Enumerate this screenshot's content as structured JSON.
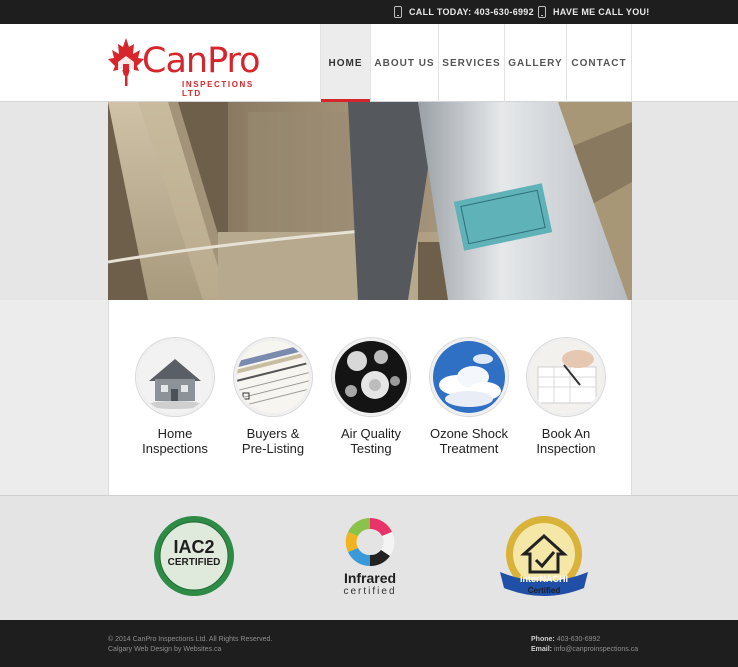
{
  "topbar": {
    "call_today": "CALL TODAY: 403-630-6992",
    "call_me": "HAVE ME CALL YOU!"
  },
  "logo": {
    "name": "CanPro",
    "subtitle": "INSPECTIONS LTD"
  },
  "nav": {
    "items": [
      {
        "label": "HOME",
        "active": true
      },
      {
        "label": "ABOUT US",
        "active": false
      },
      {
        "label": "SERVICES",
        "active": false
      },
      {
        "label": "GALLERY",
        "active": false
      },
      {
        "label": "CONTACT",
        "active": false
      }
    ]
  },
  "services": [
    {
      "line1": "Home",
      "line2": "Inspections",
      "image": "house-model"
    },
    {
      "line1": "Buyers &",
      "line2": "Pre-Listing",
      "image": "home-inspection-checklist"
    },
    {
      "line1": "Air Quality",
      "line2": "Testing",
      "image": "mold-spores"
    },
    {
      "line1": "Ozone Shock",
      "line2": "Treatment",
      "image": "blue-sky-clouds"
    },
    {
      "line1": "Book An",
      "line2": "Inspection",
      "image": "calendar-writing"
    }
  ],
  "badges": {
    "iac2": {
      "main": "IAC2",
      "sub": "CERTIFIED"
    },
    "infrared": {
      "main": "Infrared",
      "sub": "certified"
    },
    "internachi": {
      "main": "InterNACHI",
      "sub": "Certified"
    }
  },
  "footer": {
    "copyright": "© 2014 CanPro Inspections Ltd. All Rights Reserved.",
    "credit": "Calgary Web Design by Websites.ca",
    "phone_label": "Phone:",
    "phone": "403-630-6992",
    "email_label": "Email:",
    "email": "info@canproinspections.ca"
  },
  "colors": {
    "brand_red": "#d6262b",
    "topbar_bg": "#1e1e1e",
    "page_bg": "#ececec"
  }
}
